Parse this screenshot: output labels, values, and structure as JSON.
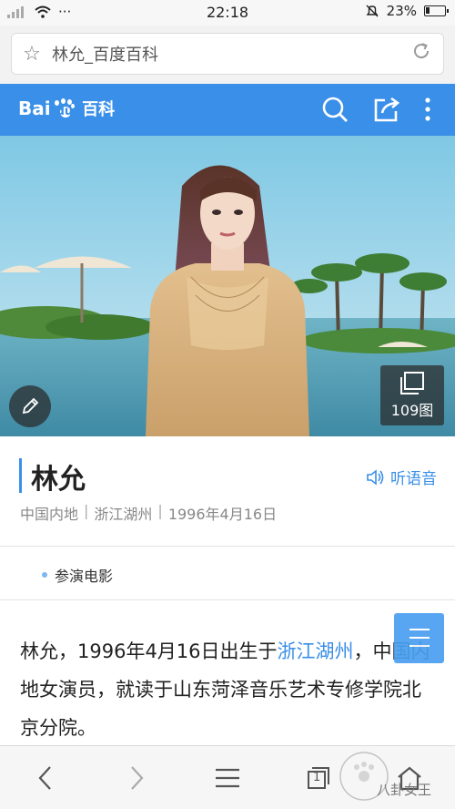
{
  "status_bar": {
    "time": "22:18",
    "dots": "···",
    "battery": "23%",
    "battery_level": 0.23
  },
  "url_bar": {
    "text": "林允_百度百科"
  },
  "header": {
    "logo_text": "Bai",
    "logo_text2": "du",
    "logo_cn": "百科"
  },
  "hero": {
    "gallery_count": "109图"
  },
  "entry": {
    "title": "林允",
    "listen_label": "听语音",
    "meta": [
      "中国内地",
      "浙江湖州",
      "1996年4月16日"
    ],
    "meta_sep": "|"
  },
  "film_tag": "参演电影",
  "summary": {
    "part1": "林允，1996年4月16日出生于",
    "link": "浙江湖州",
    "part2": "，中国内地女演员，就读于山东菏泽音乐艺术专修学院北京分院。"
  },
  "bottom_nav": {
    "tabs_count": "1"
  },
  "watermark": "八卦女王",
  "colors": {
    "accent": "#3a8fe8",
    "header_bg": "#3a8fe8"
  }
}
